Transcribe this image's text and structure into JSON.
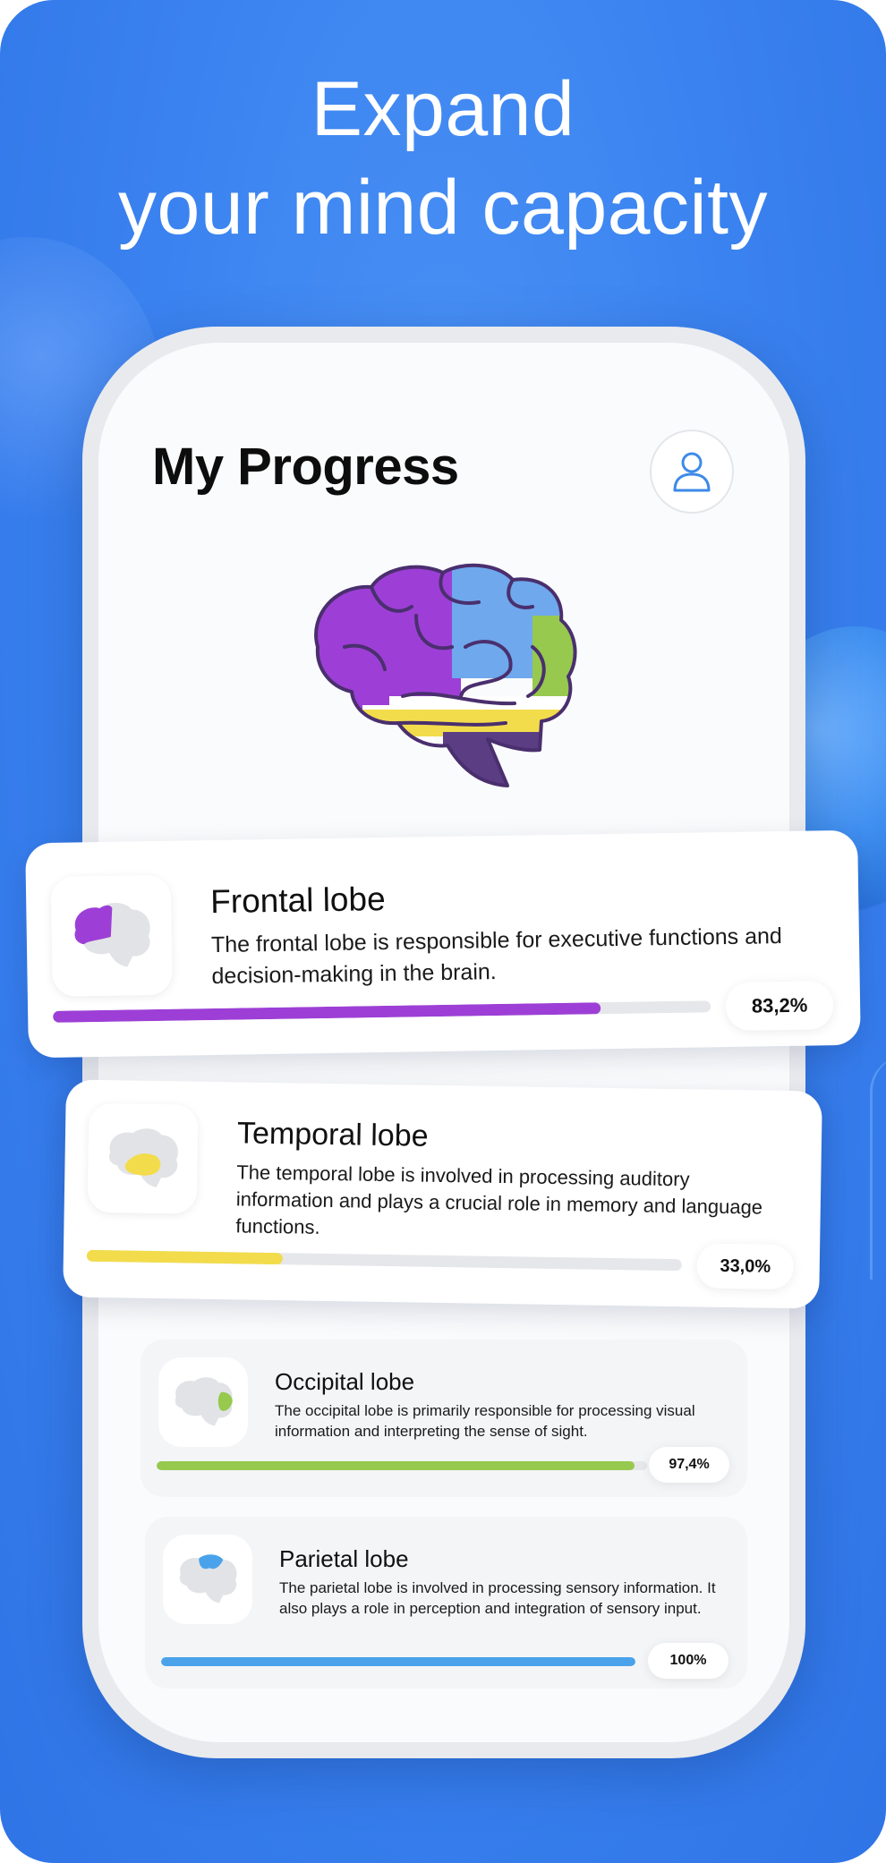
{
  "headline": {
    "line1": "Expand",
    "line2": "your mind capacity"
  },
  "screen": {
    "title": "My Progress",
    "profile_icon": "user-icon"
  },
  "lobes": [
    {
      "title": "Frontal lobe",
      "description": "The frontal lobe is responsible for executive functions and decision-making in the brain.",
      "percent_label": "83,2%",
      "progress": 0.832,
      "color": "#9d3fd6"
    },
    {
      "title": "Temporal lobe",
      "description": "The temporal lobe is involved in processing auditory information and plays a crucial role in memory and language functions.",
      "percent_label": "33,0%",
      "progress": 0.33,
      "color": "#f2dc4b"
    },
    {
      "title": "Occipital lobe",
      "description": "The occipital lobe is primarily responsible for processing visual information and interpreting the sense of sight.",
      "percent_label": "97,4%",
      "progress": 0.974,
      "color": "#96c94e"
    },
    {
      "title": "Parietal lobe",
      "description": "The parietal lobe is involved in processing sensory information. It also plays a role in perception and integration of sensory input.",
      "percent_label": "100%",
      "progress": 1.0,
      "color": "#4aa3ea"
    }
  ],
  "colors": {
    "background": "#3b83f0",
    "brain_outline": "#4a2f6e"
  }
}
